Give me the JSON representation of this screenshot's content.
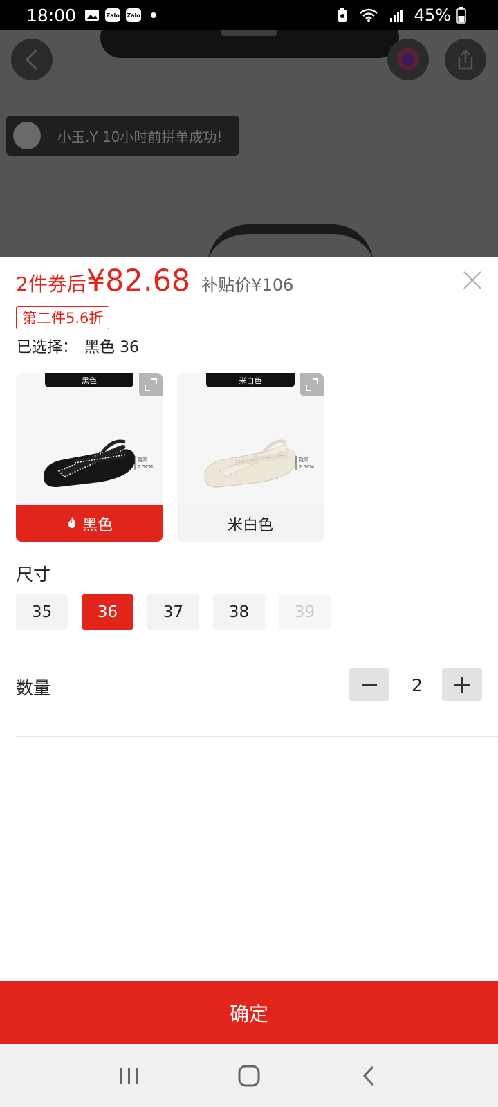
{
  "status_bar": {
    "time": "18:00",
    "battery": "45%",
    "zalo_1": "Zalo",
    "zalo_2": "Zalo"
  },
  "background": {
    "toast_text": "小玉.Y 10小时前拼单成功!"
  },
  "sheet": {
    "price_prefix": "2件券后",
    "price_amount": "¥82.68",
    "subsidy_price": "补贴价¥106",
    "promo_tag": "第二件5.6折",
    "selected_label": "已选择：",
    "selected_value": "黑色 36",
    "colors": [
      {
        "badge": "黑色",
        "label": "黑色",
        "selected": true
      },
      {
        "badge": "米白色",
        "label": "米白色",
        "selected": false
      }
    ],
    "size_title": "尺寸",
    "sizes": [
      {
        "label": "35",
        "state": "normal"
      },
      {
        "label": "36",
        "state": "selected"
      },
      {
        "label": "37",
        "state": "normal"
      },
      {
        "label": "38",
        "state": "normal"
      },
      {
        "label": "39",
        "state": "disabled"
      }
    ],
    "quantity_title": "数量",
    "quantity": "2",
    "confirm_label": "确定"
  },
  "colors": {
    "accent": "#e1251b",
    "disabled_text": "#c8c8c8"
  },
  "icons": [
    "back-icon",
    "share-icon",
    "close-icon",
    "expand-icon",
    "flame-icon",
    "minus-icon",
    "plus-icon",
    "recents-icon",
    "home-icon",
    "nav-back-icon"
  ]
}
